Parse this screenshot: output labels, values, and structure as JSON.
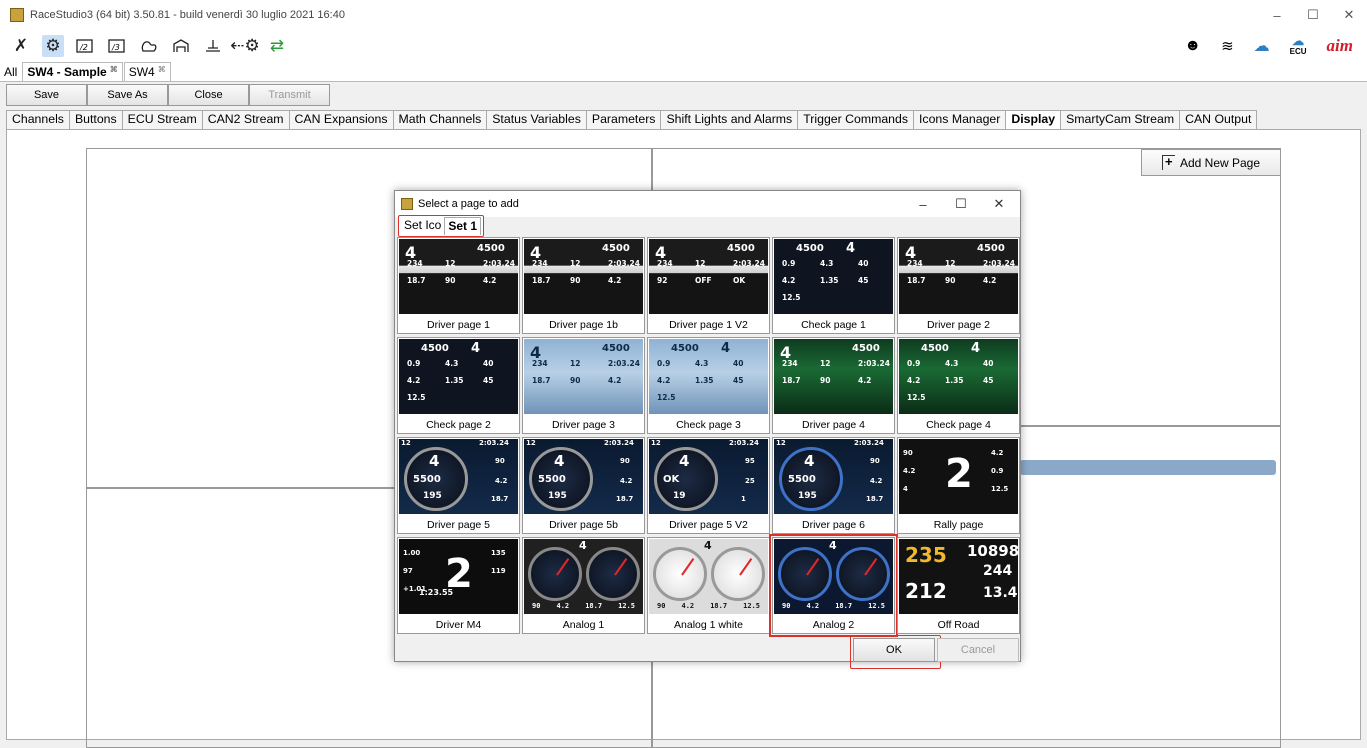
{
  "window": {
    "title": "RaceStudio3 (64 bit) 3.50.81 - build venerdì 30 luglio 2021 16:40",
    "controls": [
      "–",
      "☐",
      "✕"
    ]
  },
  "toolbar": {
    "icons": [
      "wrench-icon",
      "gear-settings-icon",
      "device-2-icon",
      "device-3-icon",
      "track-icon",
      "garage-icon",
      "water-level-icon",
      "transfer-icon",
      "download-icon"
    ],
    "right_icons": [
      "user-icon",
      "wifi-icon",
      "cloud-icon",
      "ecu-icon"
    ],
    "ecu_label": "ECU",
    "brand": "aim"
  },
  "doc_tabs": {
    "all": "All",
    "tabs": [
      {
        "label": "SW4 - Sample",
        "active": true
      },
      {
        "label": "SW4",
        "active": false
      }
    ],
    "close_glyph": "⌘"
  },
  "commands": {
    "save": "Save",
    "save_as": "Save As",
    "close": "Close",
    "transmit": "Transmit"
  },
  "config_tabs": [
    "Channels",
    "Buttons",
    "ECU Stream",
    "CAN2 Stream",
    "CAN Expansions",
    "Math Channels",
    "Status Variables",
    "Parameters",
    "Shift Lights and Alarms",
    "Trigger Commands",
    "Icons Manager",
    "Display",
    "SmartyCam Stream",
    "CAN Output"
  ],
  "active_config_tab": "Display",
  "add_page": {
    "label": "Add New Page"
  },
  "dialog": {
    "title": "Select a page to add",
    "set_tabs": [
      "Set Ico",
      "Set 1"
    ],
    "active_set": "Set 1",
    "pages": [
      {
        "label": "Driver page 1",
        "style": "driver",
        "gear": "4",
        "rpm": "4500",
        "vals": [
          "234",
          "12",
          "2:03.24",
          "18.7",
          "90",
          "4.2"
        ]
      },
      {
        "label": "Driver page 1b",
        "style": "driver",
        "gear": "4",
        "rpm": "4500",
        "vals": [
          "234",
          "12",
          "2:03.24",
          "18.7",
          "90",
          "4.2"
        ]
      },
      {
        "label": "Driver page 1 V2",
        "style": "driver",
        "gear": "4",
        "rpm": "4500",
        "vals": [
          "234",
          "12",
          "2:03.24",
          "92",
          "OFF",
          "OK"
        ]
      },
      {
        "label": "Check page 1",
        "style": "check",
        "gear": "4",
        "rpm": "4500",
        "vals": [
          "0.9",
          "4.3",
          "40",
          "4.2",
          "1.35",
          "45",
          "12.5"
        ]
      },
      {
        "label": "Driver page 2",
        "style": "driver",
        "gear": "4",
        "rpm": "4500",
        "vals": [
          "234",
          "12",
          "2:03.24",
          "18.7",
          "90",
          "4.2"
        ]
      },
      {
        "label": "Check page 2",
        "style": "check",
        "gear": "4",
        "rpm": "4500",
        "vals": [
          "0.9",
          "4.3",
          "40",
          "4.2",
          "1.35",
          "45",
          "12.5"
        ]
      },
      {
        "label": "Driver page 3",
        "style": "light",
        "gear": "4",
        "rpm": "4500",
        "vals": [
          "234",
          "12",
          "2:03.24",
          "18.7",
          "90",
          "4.2"
        ]
      },
      {
        "label": "Check page 3",
        "style": "light",
        "gear": "4",
        "rpm": "4500",
        "vals": [
          "0.9",
          "4.3",
          "40",
          "4.2",
          "1.35",
          "45",
          "12.5"
        ]
      },
      {
        "label": "Driver page 4",
        "style": "green",
        "gear": "4",
        "rpm": "4500",
        "vals": [
          "234",
          "12",
          "2:03.24",
          "18.7",
          "90",
          "4.2"
        ]
      },
      {
        "label": "Check page 4",
        "style": "green",
        "gear": "4",
        "rpm": "4500",
        "vals": [
          "0.9",
          "4.3",
          "40",
          "4.2",
          "1.35",
          "45",
          "12.5"
        ]
      },
      {
        "label": "Driver page 5",
        "style": "round",
        "gear": "4",
        "rpm": "5500",
        "vals": [
          "12",
          "2:03.24",
          "195",
          "90",
          "4.2",
          "18.7"
        ]
      },
      {
        "label": "Driver page 5b",
        "style": "round",
        "gear": "4",
        "rpm": "5500",
        "vals": [
          "12",
          "2:03.24",
          "195",
          "90",
          "4.2",
          "18.7"
        ]
      },
      {
        "label": "Driver page 5 V2",
        "style": "round",
        "gear": "4",
        "rpm": "OK",
        "vals": [
          "12",
          "2:03.24",
          "19",
          "95",
          "25",
          "1"
        ]
      },
      {
        "label": "Driver page 6",
        "style": "roundblue",
        "gear": "4",
        "rpm": "5500",
        "vals": [
          "12",
          "2:03.24",
          "195",
          "90",
          "4.2",
          "18.7"
        ]
      },
      {
        "label": "Rally page",
        "style": "rally",
        "gear": "2",
        "rpm": "",
        "vals": [
          "90",
          "4.2",
          "4.2",
          "0.9",
          "4",
          "12.5"
        ]
      },
      {
        "label": "Driver M4",
        "style": "m4",
        "gear": "2",
        "rpm": "1:23.55",
        "vals": [
          "1.00",
          "135",
          "97",
          "119",
          "+1.01"
        ]
      },
      {
        "label": "Analog 1",
        "style": "analog",
        "gear": "4",
        "rpm": "",
        "vals": [
          "90",
          "4.2",
          "18.7",
          "12.5"
        ]
      },
      {
        "label": "Analog 1 white",
        "style": "analogwhite",
        "gear": "4",
        "rpm": "",
        "vals": [
          "90",
          "4.2",
          "18.7",
          "12.5"
        ]
      },
      {
        "label": "Analog 2",
        "style": "analog2",
        "gear": "4",
        "rpm": "",
        "vals": [
          "90",
          "4.2",
          "18.7",
          "12.5"
        ],
        "selected": true
      },
      {
        "label": "Off Road",
        "style": "offroad",
        "gear": "",
        "rpm": "",
        "vals": [
          "235",
          "10898",
          "244",
          "212",
          "13.4"
        ]
      }
    ],
    "ok": "OK",
    "cancel": "Cancel"
  }
}
